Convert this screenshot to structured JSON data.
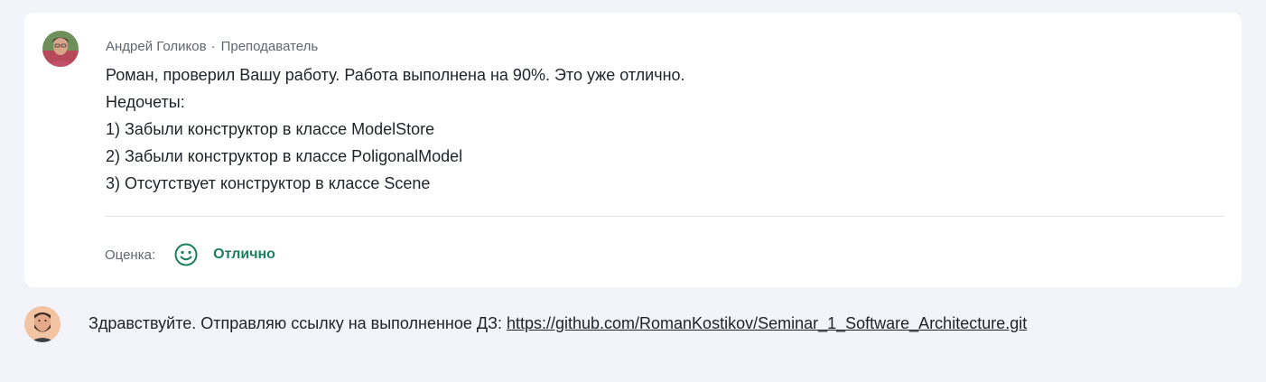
{
  "teacher_comment": {
    "author_name": "Андрей Голиков",
    "separator": "·",
    "author_role": "Преподаватель",
    "lines": [
      "Роман, проверил Вашу работу. Работа выполнена на 90%. Это уже отлично.",
      "Недочеты:",
      "1) Забыли конструктор в классе ModelStore",
      "2) Забыли конструктор в классе PoligonalModel",
      "3) Отсутствует конструктор в классе Scene"
    ],
    "grade_label": "Оценка:",
    "grade_icon": "smiley-face-icon",
    "grade_value": "Отлично",
    "grade_color": "#1a7f5e"
  },
  "student_message": {
    "text": "Здравствуйте. Отправляю ссылку на выполненное ДЗ: ",
    "link_text": "https://github.com/RomanKostikov/Seminar_1_Software_Architecture.git"
  },
  "colors": {
    "page_background": "#f3f4f9",
    "card_background": "#ffffff",
    "muted_text": "#5f6670",
    "body_text": "#1f2329"
  }
}
